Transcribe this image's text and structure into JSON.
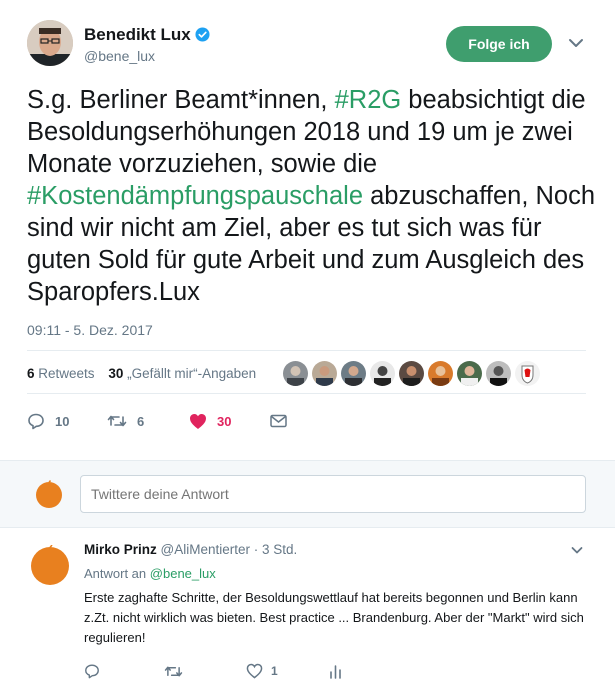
{
  "tweet": {
    "author_name": "Benedikt Lux",
    "author_handle": "@bene_lux",
    "follow_label": "Folge ich",
    "text_parts": [
      "S.g. Berliner Beamt*innen, ",
      "#R2G",
      " beabsichtigt die Besoldungserhöhungen 2018 und 19 um je zwei Monate vorzuziehen, sowie die ",
      "#Kostendämpfungspauschale",
      " abzuschaffen, Noch sind wir nicht am Ziel, aber es tut sich was für guten Sold für gute Arbeit und zum Ausgleich des Sparopfers.Lux"
    ],
    "timestamp": "09:11 - 5. Dez. 2017",
    "retweets_count": "6",
    "retweets_label": "Retweets",
    "likes_count": "30",
    "likes_label": "„Gefällt mir“-Angaben",
    "actions": {
      "replies": "10",
      "retweets": "6",
      "likes": "30"
    },
    "colors": {
      "accent": "#2a9d65",
      "follow_button": "#3f9e6e",
      "like": "#e0245e"
    }
  },
  "reply_box": {
    "placeholder": "Twittere deine Antwort"
  },
  "reply": {
    "author_name": "Mirko Prinz",
    "author_handle": "@AliMentierter",
    "time": "· 3 Std.",
    "reply_to_prefix": "Antwort an",
    "reply_to_handle": "@bene_lux",
    "text": "Erste zaghafte Schritte, der Besoldungswettlauf hat bereits begonnen und Berlin kann z.Zt. nicht wirklich was bieten. Best practice ... Brandenburg. Aber der \"Markt\" wird sich regulieren!",
    "likes": "1"
  }
}
